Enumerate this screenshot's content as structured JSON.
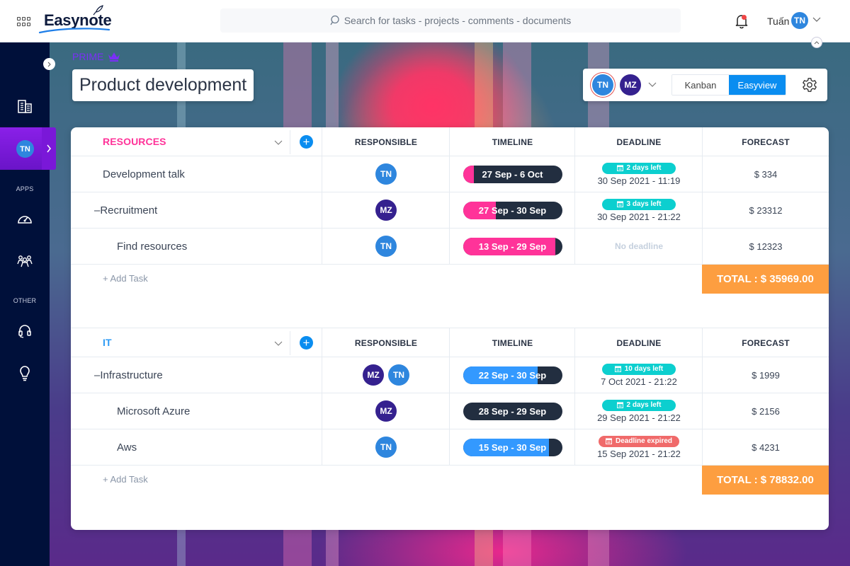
{
  "app": {
    "logo": "Easynote",
    "search_placeholder": "Search for tasks - projects - comments - documents",
    "user_name": "Tuấn",
    "user_initials": "TN"
  },
  "sidebar": {
    "active_avatar": "TN",
    "section_apps": "APPS",
    "section_other": "OTHER",
    "icons": [
      "building-icon",
      "dashboard-gauge-icon",
      "team-icon",
      "headset-icon",
      "lightbulb-icon"
    ]
  },
  "project": {
    "tier": "PRIME",
    "title": "Product development",
    "members": [
      "TN",
      "MZ"
    ],
    "views": [
      "Kanban",
      "Easyview"
    ],
    "active_view": "Easyview"
  },
  "columns": {
    "responsible": "RESPONSIBLE",
    "timeline": "TIMELINE",
    "deadline": "DEADLINE",
    "forecast": "FORECAST"
  },
  "groups": [
    {
      "name": "RESOURCES",
      "color": "#ff3399",
      "add_task": "+ Add Task",
      "total": "TOTAL : $ 35969.00",
      "tasks": [
        {
          "name": "Development talk",
          "level": 0,
          "collapse": false,
          "responsible": [
            "TN"
          ],
          "timeline": "27 Sep - 6 Oct",
          "progress": 0.11,
          "bar_color": "#ff3399",
          "badge": "2 days left",
          "badge_type": "ok",
          "deadline": "30 Sep 2021 - 11:19",
          "forecast": "$ 334"
        },
        {
          "name": "Recruitment",
          "level": 0,
          "collapse": true,
          "responsible": [
            "MZ"
          ],
          "timeline": "27 Sep - 30 Sep",
          "progress": 0.33,
          "bar_color": "#ff3399",
          "badge": "3 days left",
          "badge_type": "ok",
          "deadline": "30 Sep 2021 - 21:22",
          "forecast": "$ 23312"
        },
        {
          "name": "Find resources",
          "level": 1,
          "collapse": false,
          "responsible": [
            "TN"
          ],
          "timeline": "13 Sep - 29 Sep",
          "progress": 0.93,
          "bar_color": "#ff3399",
          "badge": "",
          "badge_type": "none",
          "deadline": "No deadline",
          "forecast": "$ 12323"
        }
      ]
    },
    {
      "name": "IT",
      "color": "#2e9bf5",
      "add_task": "+ Add Task",
      "total": "TOTAL : $ 78832.00",
      "tasks": [
        {
          "name": "Infrastructure",
          "level": 0,
          "collapse": true,
          "responsible": [
            "MZ",
            "TN"
          ],
          "timeline": "22 Sep - 30 Sep",
          "progress": 0.75,
          "bar_color": "#3399ff",
          "badge": "10 days left",
          "badge_type": "ok",
          "deadline": "7 Oct 2021 - 21:22",
          "forecast": "$ 1999"
        },
        {
          "name": "Microsoft Azure",
          "level": 1,
          "collapse": false,
          "responsible": [
            "MZ"
          ],
          "timeline": "28 Sep - 29 Sep",
          "progress": 0.0,
          "bar_color": "#3399ff",
          "badge": "2 days left",
          "badge_type": "ok",
          "deadline": "29 Sep 2021 - 21:22",
          "forecast": "$ 2156"
        },
        {
          "name": "Aws",
          "level": 1,
          "collapse": false,
          "responsible": [
            "TN"
          ],
          "timeline": "15 Sep - 30 Sep",
          "progress": 0.87,
          "bar_color": "#3399ff",
          "badge": "Deadline expired",
          "badge_type": "expired",
          "deadline": "15 Sep 2021 - 21:22",
          "forecast": "$ 4231"
        }
      ]
    }
  ]
}
